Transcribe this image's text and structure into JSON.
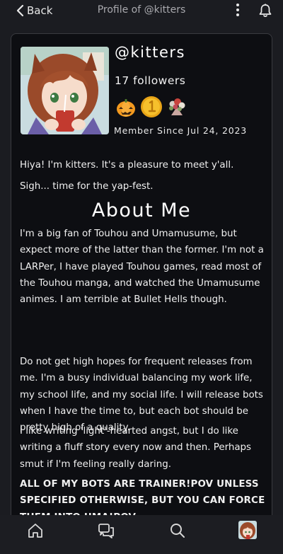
{
  "header": {
    "back_label": "Back",
    "title": "Profile of @kitters"
  },
  "profile": {
    "username": "@kitters",
    "followers": "17 followers",
    "member_since": "Member Since Jul 24, 2023",
    "badges": [
      "pumpkin-badge",
      "gold-coin-badge",
      "flower-bouquet-badge"
    ]
  },
  "bio": {
    "line1": "Hiya! I'm kitters. It's a pleasure to meet y'all.",
    "line2": "Sigh... time for the yap-fest.",
    "about_heading": "About Me",
    "paragraph1": "I'm a big fan of Touhou and Umamusume, but expect more of the latter than the former. I'm not a LARPer, I have played Touhou games, read most of the Touhou manga, and watched the Umamusume animes. I am terrible at Bullet Hells though.",
    "paragraph2": "Do not get high hopes for frequent releases from me. I'm a busy individual balancing my work life, my school life, and my social life. I will release bots when I have the time to, but each bot should be pretty high of a quality.",
    "paragraph3": "I like writing 'light'-hearted angst, but I do like writing a fluff story every now and then. Perhaps smut if I'm feeling really daring.",
    "paragraph4": "ALL OF MY BOTS ARE TRAINER!POV UNLESS SPECIFIED OTHERWISE, BUT YOU CAN FORCE THEM INTO UMA!POV"
  },
  "nav": {
    "items": [
      "home-icon",
      "chat-icon",
      "search-icon",
      "profile-avatar"
    ]
  },
  "colors": {
    "background": "#1b1c21",
    "card": "#0d0e12",
    "card_border": "#3a3b40",
    "text": "#f0f0f0",
    "muted": "#a9a9ae"
  }
}
